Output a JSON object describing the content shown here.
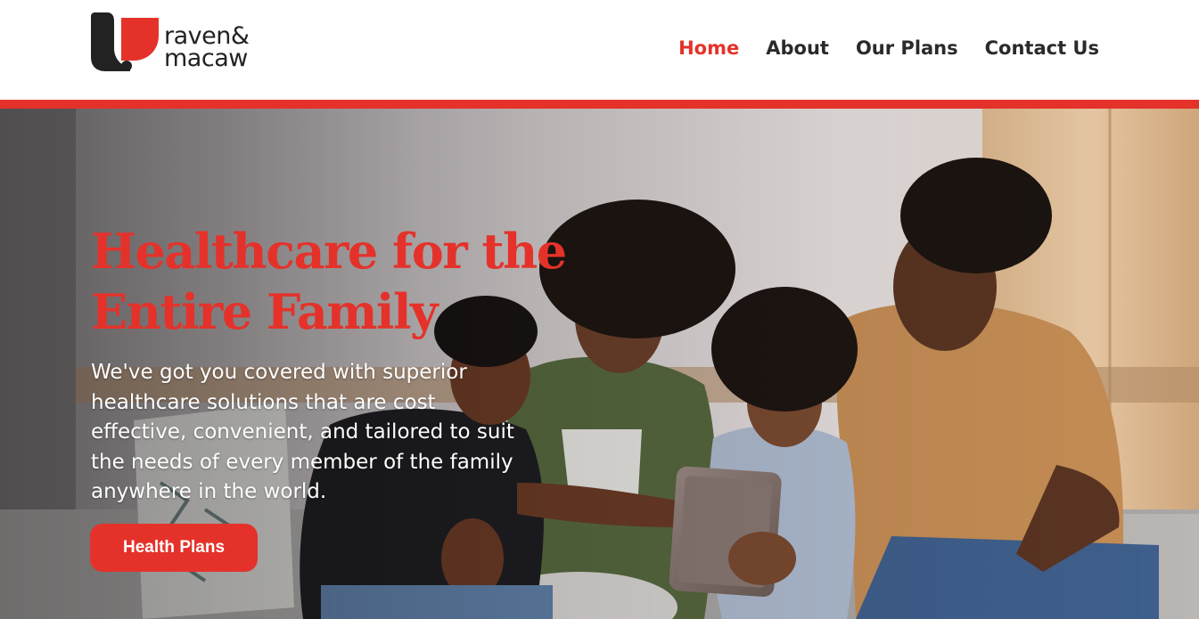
{
  "brand": {
    "name_line1": "raven&",
    "name_line2": "macaw",
    "accent_color": "#e4322b"
  },
  "nav": {
    "items": [
      {
        "label": "Home",
        "active": true
      },
      {
        "label": "About",
        "active": false
      },
      {
        "label": "Our Plans",
        "active": false
      },
      {
        "label": "Contact Us",
        "active": false
      }
    ]
  },
  "hero": {
    "title_line1": "Healthcare for the",
    "title_line2": "Entire Family",
    "body": "We've got you covered with superior healthcare solutions that are cost effective, convenient, and tailored to suit the needs of every member of the family anywhere in the world.",
    "cta_label": "Health Plans",
    "image": "family-on-couch-with-tablet-photo"
  }
}
